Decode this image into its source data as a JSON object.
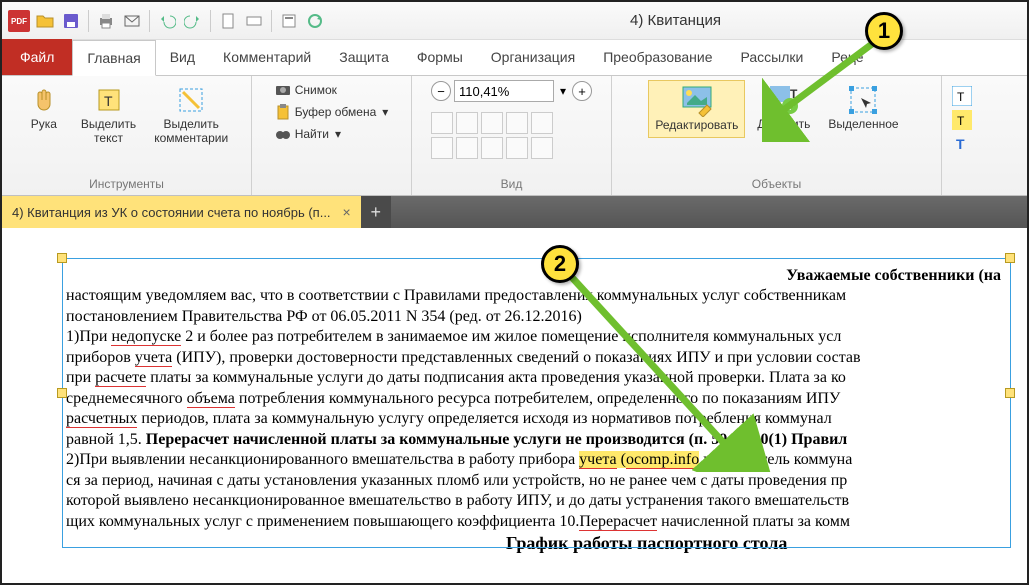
{
  "window_title": "4) Квитанция",
  "tabs": {
    "file": "Файл",
    "items": [
      "Главная",
      "Вид",
      "Комментарий",
      "Защита",
      "Формы",
      "Организация",
      "Преобразование",
      "Рассылки",
      "Реце"
    ],
    "active_index": 0
  },
  "ribbon": {
    "tools_group_label": "Инструменты",
    "hand": "Рука",
    "select_text": "Выделить\nтекст",
    "select_comments": "Выделить\nкомментарии",
    "snapshot": "Снимок",
    "clipboard": "Буфер обмена",
    "find": "Найти",
    "view_group_label": "Вид",
    "zoom_value": "110,41%",
    "edit": "Редактировать",
    "add": "Добавить",
    "selected": "Выделенное",
    "objects_group_label": "Объекты"
  },
  "doc_tab": {
    "title": "4) Квитанция из УК о состоянии счета по ноябрь (п...",
    "close": "×"
  },
  "callouts": {
    "one": "1",
    "two": "2"
  },
  "document": {
    "heading": "Уважаемые собственники (на",
    "p1_a": "настоящим уведомляем вас, что в соответствии с Правилами предоставления коммунальных услуг собственникам",
    "p1_b": "постановлением Правительства РФ от 06.05.2011 N 354 (ред. от 26.12.2016)",
    "p2_a": "1)При ",
    "p2_u1": "недопуске",
    "p2_b": " 2 и более раз потребителем в занимаемое им жилое помещение исполнителя коммунальных усл",
    "p3_a": "приборов ",
    "p3_u1": "учета",
    "p3_b": " (ИПУ), проверки достоверности представленных сведений о показаниях ИПУ и при условии состав",
    "p4_a": "при ",
    "p4_u1": "расчете",
    "p4_b": " платы за коммунальные услуги до даты подписания акта проведения указанной проверки. Плата за ко",
    "p5_a": "среднемесячного ",
    "p5_u1": "объема",
    "p5_b": " потребления коммунального ресурса потребителем, определенного по показаниям ИПУ ",
    "p6_a": "расчетных",
    "p6_b": " периодов, плата за коммунальную услугу определяется исходя из нормативов потребления коммунал",
    "p7_a": "равной 1,5. ",
    "p7_bold": "Перерасчет начисленной платы за коммунальные услуги не производится (п. 59, п. 60(1) Правил",
    "p8_a": "2)При выявлении несанкционированного вмешательства в работу прибора ",
    "p8_hl1": "учета",
    "p8_b": " (",
    "p8_hl2": "ocomp.info",
    "p8_c": " исполнитель коммуна",
    "p9": "ся за период, начиная с даты установления указанных пломб или устройств, но не ранее чем с даты проведения пр",
    "p10": "которой выявлено несанкционированное вмешательство в работу ИПУ, и до даты устранения такого вмешательств",
    "p11_a": "щих коммунальных услуг с применением повышающего коэффициента 10.",
    "p11_u": "Перерасчет",
    "p11_b": " начисленной платы за комм",
    "subheading": "График работы паспортного стола"
  }
}
